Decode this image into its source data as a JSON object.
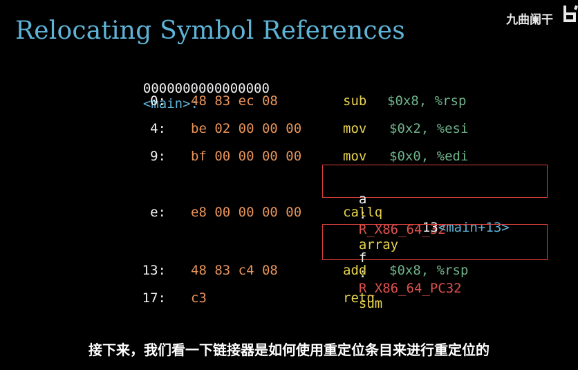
{
  "title": "Relocating Symbol References",
  "watermark": "九曲阑干",
  "colors": {
    "title": "#5fb3d6",
    "hex": "#e8945a",
    "mnemonic": "#e8d44d",
    "operand": "#6fb38a",
    "relocation": "#e0524f",
    "box": "#d8403d"
  },
  "header": {
    "address": "0000000000000000",
    "symbol": "<main>:"
  },
  "rows": [
    {
      "addr": "0:",
      "bytes": "48 83 ec 08",
      "mnemonic": "sub",
      "operands": "$0x8, %rsp"
    },
    {
      "addr": "4:",
      "bytes": "be 02 00 00 00",
      "mnemonic": "mov",
      "operands": "$0x2, %esi"
    },
    {
      "addr": "9:",
      "bytes": "bf 00 00 00 00",
      "mnemonic": "mov",
      "operands": "$0x0, %edi"
    },
    {
      "addr": "e:",
      "bytes": "e8 00 00 00 00",
      "mnemonic": "callq",
      "target": "13",
      "target_label": "<main+13>"
    },
    {
      "addr": "13:",
      "bytes": "48 83 c4 08",
      "mnemonic": "add",
      "operands": "$0x8, %rsp"
    },
    {
      "addr": "17:",
      "bytes": "c3",
      "mnemonic": "retq"
    }
  ],
  "relocations": [
    {
      "offset": "a",
      "sep": ":",
      "type": "R_X86_64_32",
      "symbol": "array"
    },
    {
      "offset": "f",
      "sep": ":",
      "type": "R_X86_64_PC32",
      "symbol": "sum"
    }
  ],
  "subtitle": "接下来，我们看一下链接器是如何使用重定位条目来进行重定位的"
}
